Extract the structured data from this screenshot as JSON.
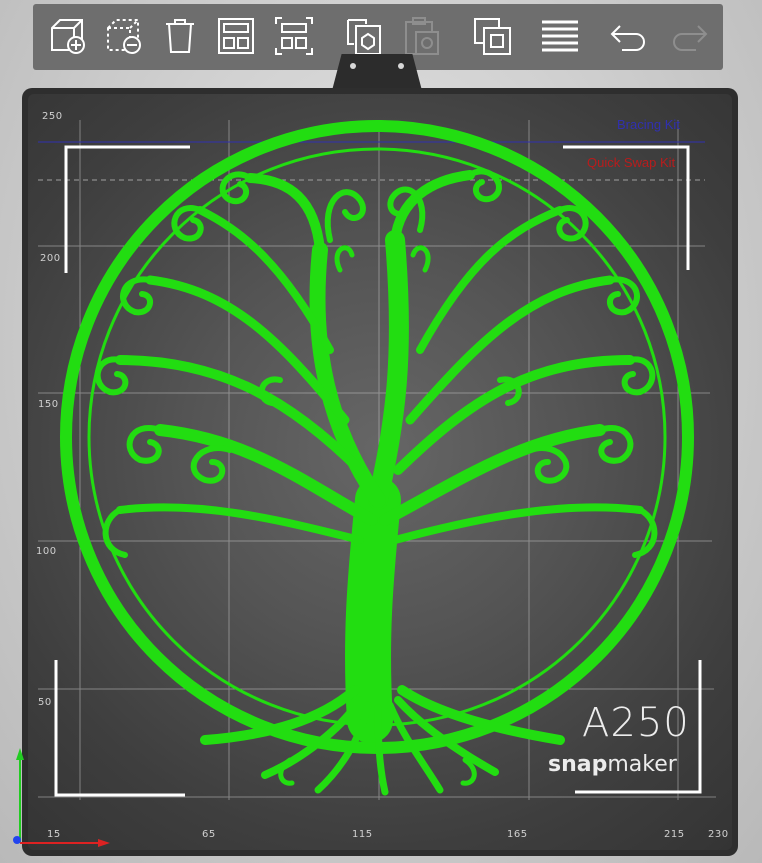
{
  "toolbar": {
    "buttons": [
      {
        "name": "add-model-button",
        "icon": "cube-plus-icon"
      },
      {
        "name": "remove-model-button",
        "icon": "cube-minus-icon"
      },
      {
        "name": "delete-button",
        "icon": "trash-icon"
      },
      {
        "name": "arrange-button",
        "icon": "arrange-icon"
      },
      {
        "name": "auto-layout-button",
        "icon": "layout-icon"
      },
      {
        "name": "copy-button",
        "icon": "copy-icon"
      },
      {
        "name": "paste-button",
        "icon": "paste-icon",
        "disabled": true
      },
      {
        "name": "duplicate-button",
        "icon": "duplicate-icon"
      },
      {
        "name": "layers-button",
        "icon": "layers-icon"
      },
      {
        "name": "undo-button",
        "icon": "undo-icon"
      },
      {
        "name": "redo-button",
        "icon": "redo-icon",
        "disabled": true
      }
    ]
  },
  "plate": {
    "kits": {
      "bracing": {
        "label": "Bracing Kit",
        "color": "#3030b0"
      },
      "quick_swap": {
        "label": "Quick Swap Kit",
        "color": "#b81c1c"
      }
    },
    "brand": {
      "model": "A250",
      "name_bold": "snap",
      "name_light": "maker"
    },
    "model_color": "#22dd11",
    "x_ticks": [
      "15",
      "65",
      "115",
      "165",
      "215",
      "230"
    ],
    "y_ticks": [
      "250",
      "200",
      "150",
      "100",
      "50"
    ]
  }
}
